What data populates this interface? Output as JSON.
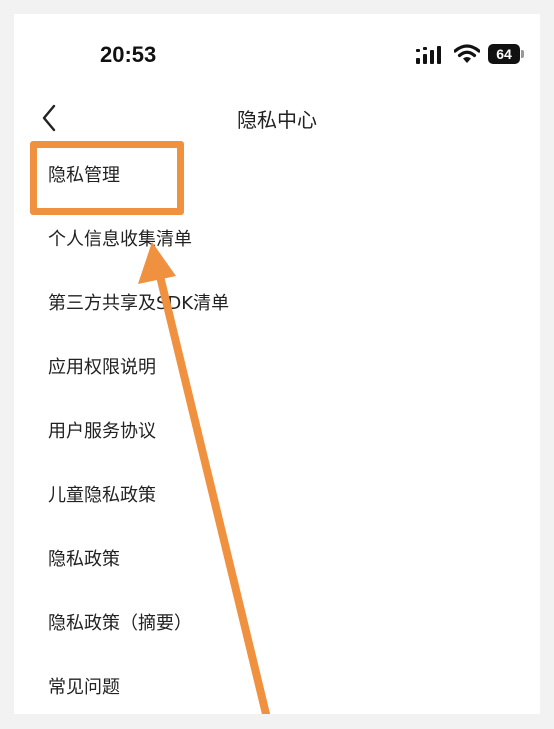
{
  "status_bar": {
    "time": "20:53",
    "battery": "64"
  },
  "nav": {
    "title": "隐私中心",
    "back_icon": "chevron-left-icon"
  },
  "menu": {
    "items": [
      {
        "label": "隐私管理"
      },
      {
        "label": "个人信息收集清单"
      },
      {
        "label": "第三方共享及SDK清单"
      },
      {
        "label": "应用权限说明"
      },
      {
        "label": "用户服务协议"
      },
      {
        "label": "儿童隐私政策"
      },
      {
        "label": "隐私政策"
      },
      {
        "label": "隐私政策（摘要）"
      },
      {
        "label": "常见问题"
      }
    ]
  },
  "annotation": {
    "highlight_color": "#f0913f",
    "arrow_color": "#f0913f"
  }
}
